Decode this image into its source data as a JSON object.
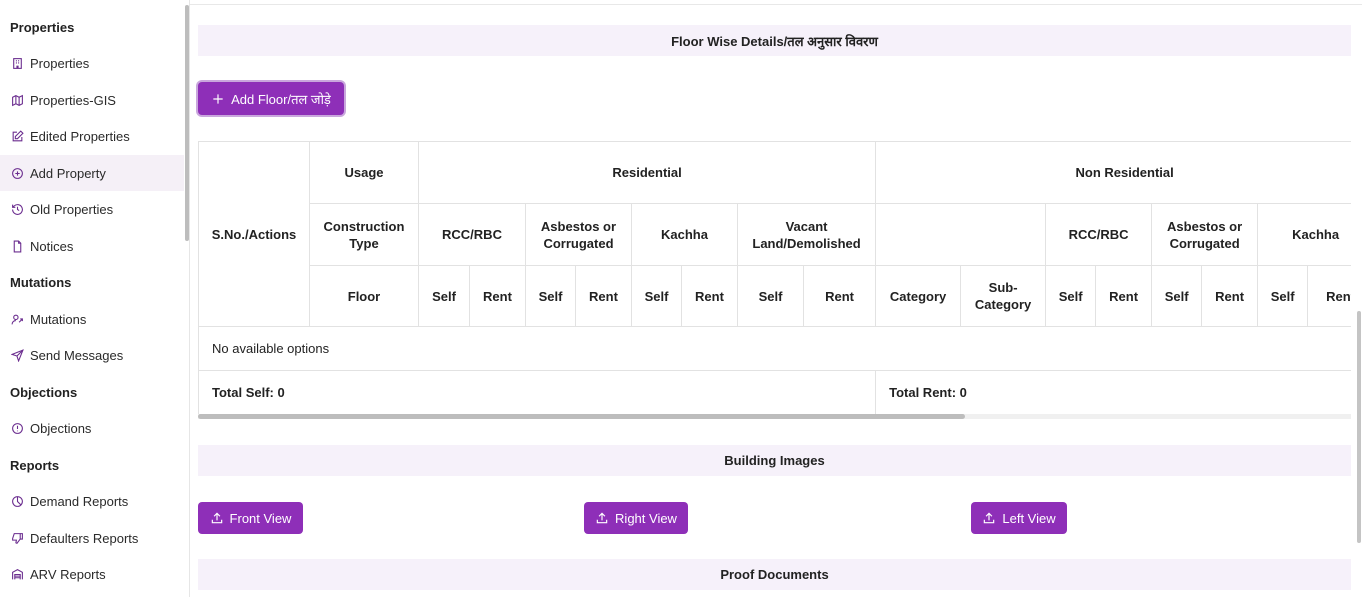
{
  "sidebar": {
    "sections": [
      {
        "title": "Properties"
      },
      {
        "title": "Mutations"
      },
      {
        "title": "Objections"
      },
      {
        "title": "Reports"
      }
    ],
    "items": [
      {
        "label": "Properties",
        "icon": "building-icon"
      },
      {
        "label": "Properties-GIS",
        "icon": "map-icon"
      },
      {
        "label": "Edited Properties",
        "icon": "edit-icon"
      },
      {
        "label": "Add Property",
        "icon": "plus-circle-icon",
        "active": true
      },
      {
        "label": "Old Properties",
        "icon": "history-icon"
      },
      {
        "label": "Notices",
        "icon": "file-icon"
      },
      {
        "label": "Mutations",
        "icon": "user-transfer-icon"
      },
      {
        "label": "Send Messages",
        "icon": "send-icon"
      },
      {
        "label": "Objections",
        "icon": "alert-circle-icon"
      },
      {
        "label": "Demand Reports",
        "icon": "pie-chart-icon"
      },
      {
        "label": "Defaulters Reports",
        "icon": "thumbs-down-icon"
      },
      {
        "label": "ARV Reports",
        "icon": "warehouse-icon"
      }
    ]
  },
  "floor_section": {
    "title": "Floor Wise Details/तल अनुसार विवरण",
    "add_floor_label": "Add Floor/तल जोड़े"
  },
  "table": {
    "sno_header": "S.No./Actions",
    "usage_header": "Usage",
    "construction_type_header": "Construction Type",
    "floor_header": "Floor",
    "residential_header": "Residential",
    "non_residential_header": "Non Residential",
    "rcc": "RCC/RBC",
    "asbestos": "Asbestos or Corrugated",
    "kachha": "Kachha",
    "vacant": "Vacant Land/Demolished",
    "self": "Self",
    "rent": "Rent",
    "category": "Category",
    "sub_category": "Sub-Category",
    "empty_text": "No available options",
    "total_self": "Total Self: 0",
    "total_rent": "Total Rent: 0"
  },
  "building_images": {
    "title": "Building Images",
    "front_view": "Front View",
    "right_view": "Right View",
    "left_view": "Left View"
  },
  "proof_documents": {
    "title": "Proof Documents"
  },
  "colors": {
    "accent": "#8e2fb8",
    "band_bg": "#f6f1fa",
    "icon": "#6b2d8f"
  }
}
